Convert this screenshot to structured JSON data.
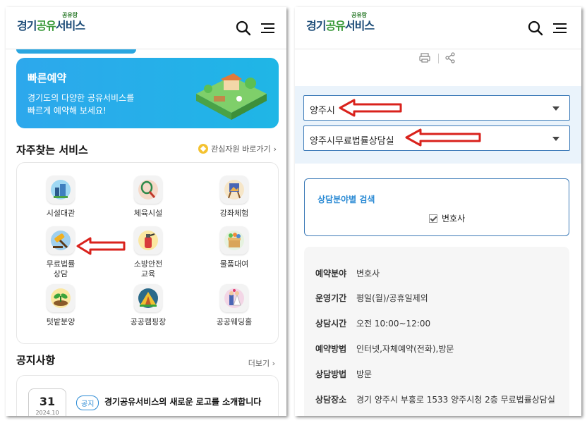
{
  "left": {
    "logo": {
      "part1": "경기",
      "part2": "공유",
      "part3": "서비스",
      "sup": "공유랑"
    },
    "banner": {
      "title": "빠른예약",
      "desc_line1": "경기도의 다양한 공유서비스를",
      "desc_line2": "빠르게 예약해 보세요!"
    },
    "frequent": {
      "title": "자주찾는 서비스",
      "fav_link": "관심자원 바로가기",
      "items": [
        {
          "label": "시설대관",
          "icon": "building-icon"
        },
        {
          "label": "체육시설",
          "icon": "racket-icon"
        },
        {
          "label": "강좌체험",
          "icon": "easel-icon"
        },
        {
          "label": "무료법률\n상담",
          "icon": "gavel-icon"
        },
        {
          "label": "소방안전\n교육",
          "icon": "fire-extinguisher-icon"
        },
        {
          "label": "물품대여",
          "icon": "box-icon"
        },
        {
          "label": "텃밭분양",
          "icon": "sprout-icon"
        },
        {
          "label": "공공캠핑장",
          "icon": "tent-icon"
        },
        {
          "label": "공공웨딩홀",
          "icon": "wedding-icon"
        }
      ]
    },
    "notice": {
      "title": "공지사항",
      "more": "더보기",
      "day": "31",
      "date_sub": "2024.10",
      "tag": "공지",
      "headline": "경기공유서비스의 새로운 로고를 소개합니다"
    }
  },
  "right": {
    "logo": {
      "part1": "경기",
      "part2": "공유",
      "part3": "서비스",
      "sup": "공유랑"
    },
    "select_city": "양주시",
    "select_service": "양주시무료법률상담실",
    "search": {
      "title": "상담분야별 검색",
      "checkbox_label": "변호사"
    },
    "details": [
      {
        "k": "예약분야",
        "v": "변호사"
      },
      {
        "k": "운영기간",
        "v": "평일(월)/공휴일제외"
      },
      {
        "k": "상담시간",
        "v": "오전 10:00~12:00"
      },
      {
        "k": "예약방법",
        "v": "인터넷,자체예약(전화),방문"
      },
      {
        "k": "상담방법",
        "v": "방문"
      },
      {
        "k": "상담장소",
        "v": "경기 양주시 부흥로 1533 양주시청 2층 무료법률상담실"
      }
    ]
  },
  "colors": {
    "accent_blue": "#2aa6e0",
    "border_blue": "#3d7bb8",
    "arrow_red": "#d9221c"
  }
}
